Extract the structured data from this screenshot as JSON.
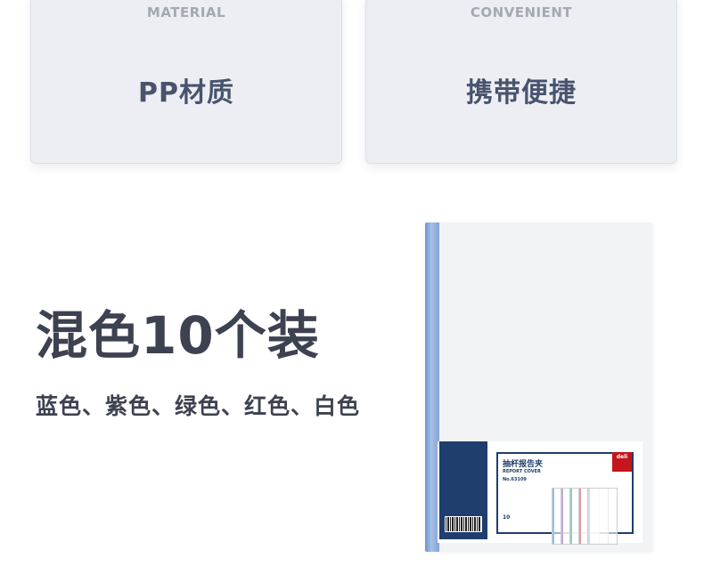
{
  "cards": [
    {
      "en": "MATERIAL",
      "cn": "PP材质"
    },
    {
      "en": "CONVENIENT",
      "cn": "携带便捷"
    }
  ],
  "headline": "混色10个装",
  "colors_line": "蓝色、紫色、绿色、红色、白色",
  "product": {
    "brand": "deli",
    "title_cn": "抽杆报告夹",
    "title_en": "REPORT COVER",
    "model": "No.63109",
    "qty": "10",
    "spine_color": "#7fa2d6",
    "mini_colors": [
      "#8ec3e6",
      "#c9a8d8",
      "#8fd0b4",
      "#e79aa4",
      "#d9dbe0"
    ]
  }
}
